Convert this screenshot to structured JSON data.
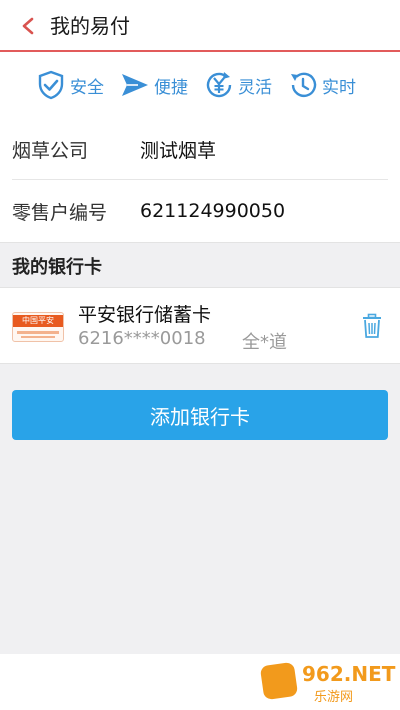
{
  "header": {
    "title": "我的易付",
    "back_icon": "chevron-left-icon"
  },
  "features": [
    {
      "label": "安全",
      "icon": "shield-check-icon"
    },
    {
      "label": "便捷",
      "icon": "paper-plane-icon"
    },
    {
      "label": "灵活",
      "icon": "yen-cycle-icon"
    },
    {
      "label": "实时",
      "icon": "clock-history-icon"
    }
  ],
  "info": {
    "company_label": "烟草公司",
    "company_value": "测试烟草",
    "retailer_label": "零售户编号",
    "retailer_value": "621124990050"
  },
  "bank_section": {
    "title": "我的银行卡"
  },
  "card": {
    "logo_text": "中国平安",
    "name": "平安银行储蓄卡",
    "number": "6216****0018",
    "holder": "全*道",
    "delete_icon": "trash-icon"
  },
  "add_button": {
    "label": "添加银行卡"
  },
  "watermark": {
    "brand": "962.NET",
    "sub": "乐游网"
  },
  "colors": {
    "accent": "#3a8fd6",
    "button": "#29a3e8",
    "header_rule": "#e25b5b",
    "logo": "#e85a1f"
  }
}
